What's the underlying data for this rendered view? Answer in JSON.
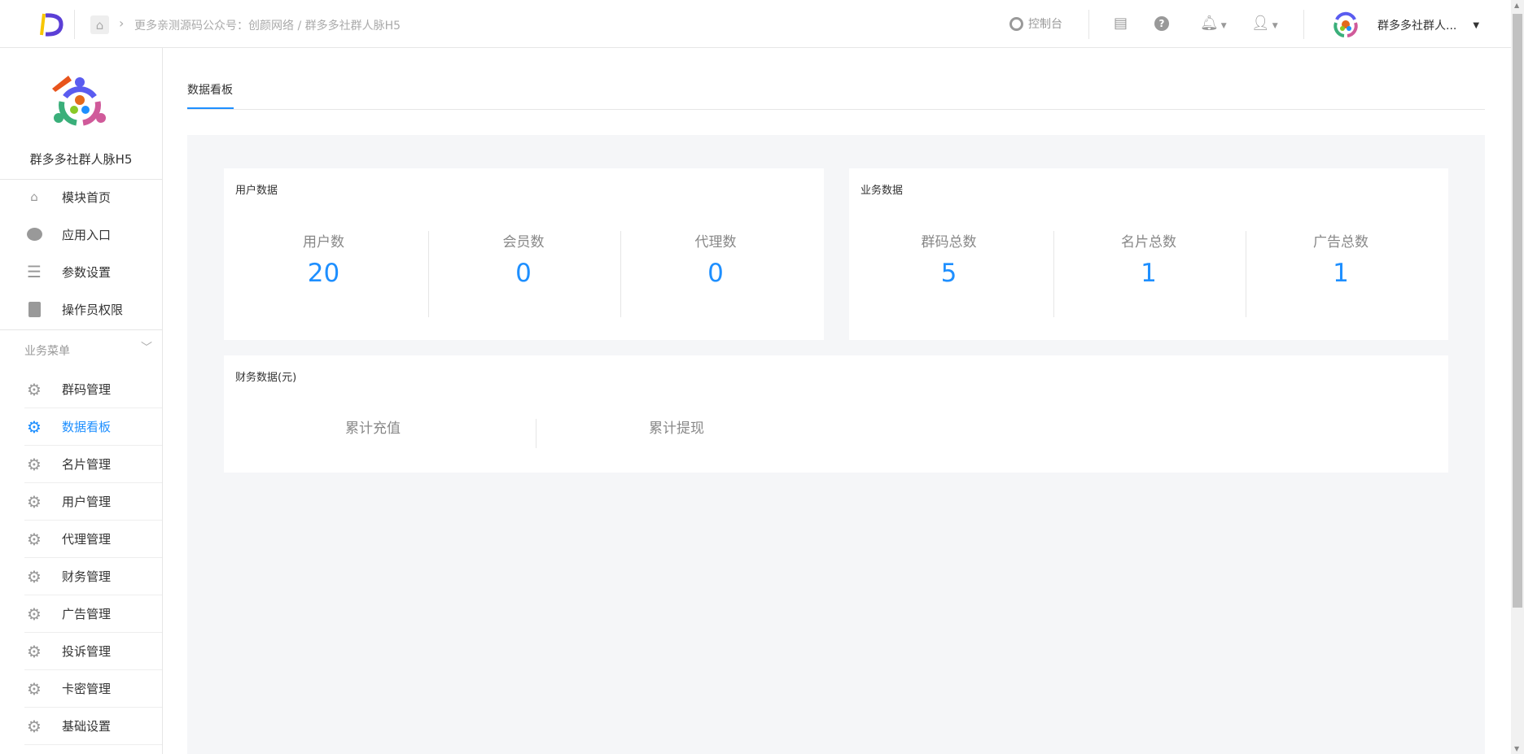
{
  "header": {
    "breadcrumb": "更多亲测源码公众号：创颜网络 / 群多多社群人脉H5",
    "console_label": "控制台",
    "account_name": "群多多社群人..."
  },
  "sidebar": {
    "app_name": "群多多社群人脉H5",
    "top_items": [
      {
        "label": "模块首页"
      },
      {
        "label": "应用入口"
      },
      {
        "label": "参数设置"
      },
      {
        "label": "操作员权限"
      }
    ],
    "section_label": "业务菜单",
    "items": [
      {
        "label": "群码管理"
      },
      {
        "label": "数据看板"
      },
      {
        "label": "名片管理"
      },
      {
        "label": "用户管理"
      },
      {
        "label": "代理管理"
      },
      {
        "label": "财务管理"
      },
      {
        "label": "广告管理"
      },
      {
        "label": "投诉管理"
      },
      {
        "label": "卡密管理"
      },
      {
        "label": "基础设置"
      }
    ],
    "active_item": "数据看板"
  },
  "main": {
    "tab": "数据看板",
    "user_card": {
      "title": "用户数据",
      "stats": [
        {
          "label": "用户数",
          "value": "20"
        },
        {
          "label": "会员数",
          "value": "0"
        },
        {
          "label": "代理数",
          "value": "0"
        }
      ]
    },
    "biz_card": {
      "title": "业务数据",
      "stats": [
        {
          "label": "群码总数",
          "value": "5"
        },
        {
          "label": "名片总数",
          "value": "1"
        },
        {
          "label": "广告总数",
          "value": "1"
        }
      ]
    },
    "finance_card": {
      "title": "财务数据(元)",
      "stats": [
        {
          "label": "累计充值"
        },
        {
          "label": "累计提现"
        }
      ]
    }
  },
  "colors": {
    "accent": "#1e8fff",
    "bg": "#f5f6f8"
  }
}
